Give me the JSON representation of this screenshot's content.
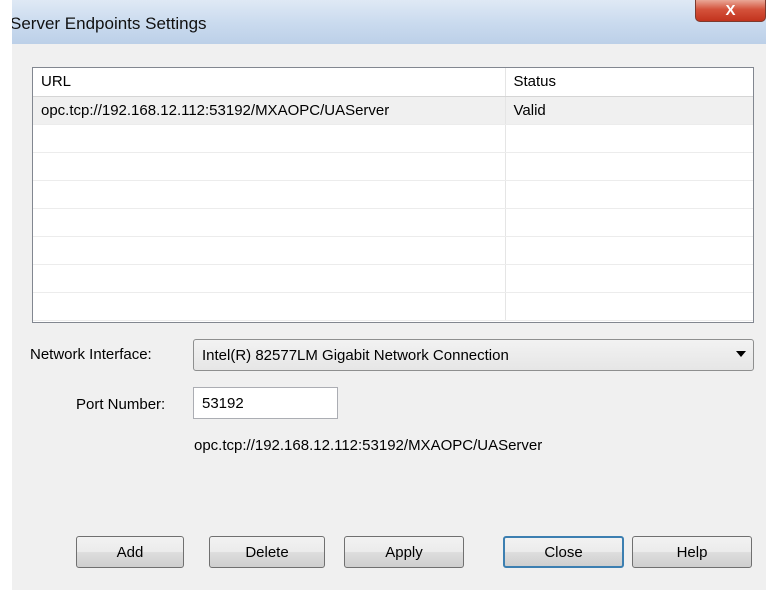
{
  "window": {
    "title": "Server Endpoints Settings",
    "close_label": "X"
  },
  "table": {
    "headers": {
      "url": "URL",
      "status": "Status"
    },
    "rows": [
      {
        "url": "opc.tcp://192.168.12.112:53192/MXAOPC/UAServer",
        "status": "Valid"
      }
    ]
  },
  "form": {
    "network_interface_label": "Network Interface:",
    "network_interface_value": "Intel(R) 82577LM Gigabit Network Connection",
    "port_label": "Port Number:",
    "port_value": "53192",
    "endpoint_preview": "opc.tcp://192.168.12.112:53192/MXAOPC/UAServer"
  },
  "buttons": {
    "add": "Add",
    "delete": "Delete",
    "apply": "Apply",
    "close": "Close",
    "help": "Help"
  }
}
